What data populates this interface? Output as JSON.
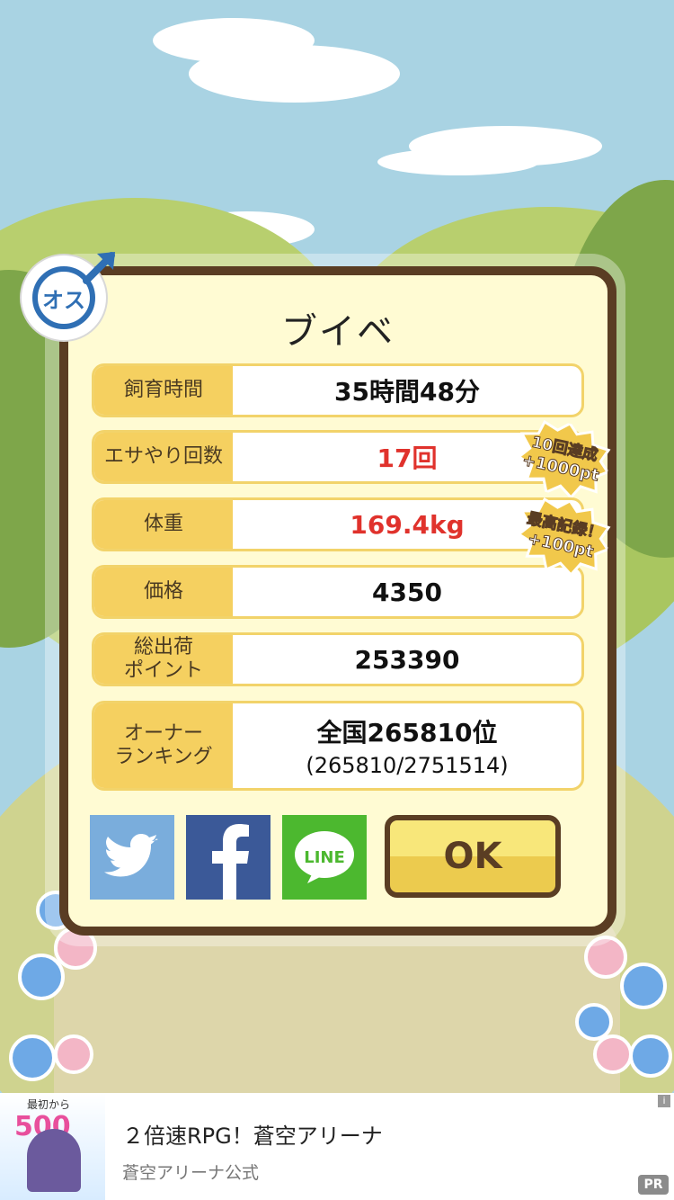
{
  "pet": {
    "name": "ブイベ",
    "gender_label": "オス"
  },
  "stats": [
    {
      "label": "飼育時間",
      "value": "35時間48分",
      "highlight": false
    },
    {
      "label": "エサやり回数",
      "value": "17回",
      "highlight": true
    },
    {
      "label": "体重",
      "value": "169.4kg",
      "highlight": true
    },
    {
      "label": "価格",
      "value": "4350",
      "highlight": false
    },
    {
      "label": "総出荷\nポイント",
      "value": "253390",
      "highlight": false
    },
    {
      "label": "オーナー\nランキング",
      "value": "全国265810位",
      "sub": "(265810/2751514)",
      "highlight": false
    }
  ],
  "badges": [
    {
      "top": "10回達成",
      "points": "+1000pt"
    },
    {
      "top": "最高記録！",
      "points": "+100pt"
    }
  ],
  "buttons": {
    "twitter": "twitter-share",
    "facebook": "facebook-share",
    "line": "LINE",
    "ok": "OK"
  },
  "ad": {
    "title": "２倍速RPG！蒼空アリーナ",
    "sponsor": "蒼空アリーナ公式",
    "thumb_text": "500",
    "thumb_small": "最初から",
    "pr": "PR",
    "info": "i"
  },
  "colors": {
    "panel_border": "#5a3d23",
    "label_bg": "#f5d060",
    "highlight_value": "#e0322c",
    "twitter": "#6fa8dc",
    "facebook": "#3b5998",
    "line": "#4cb82f"
  }
}
